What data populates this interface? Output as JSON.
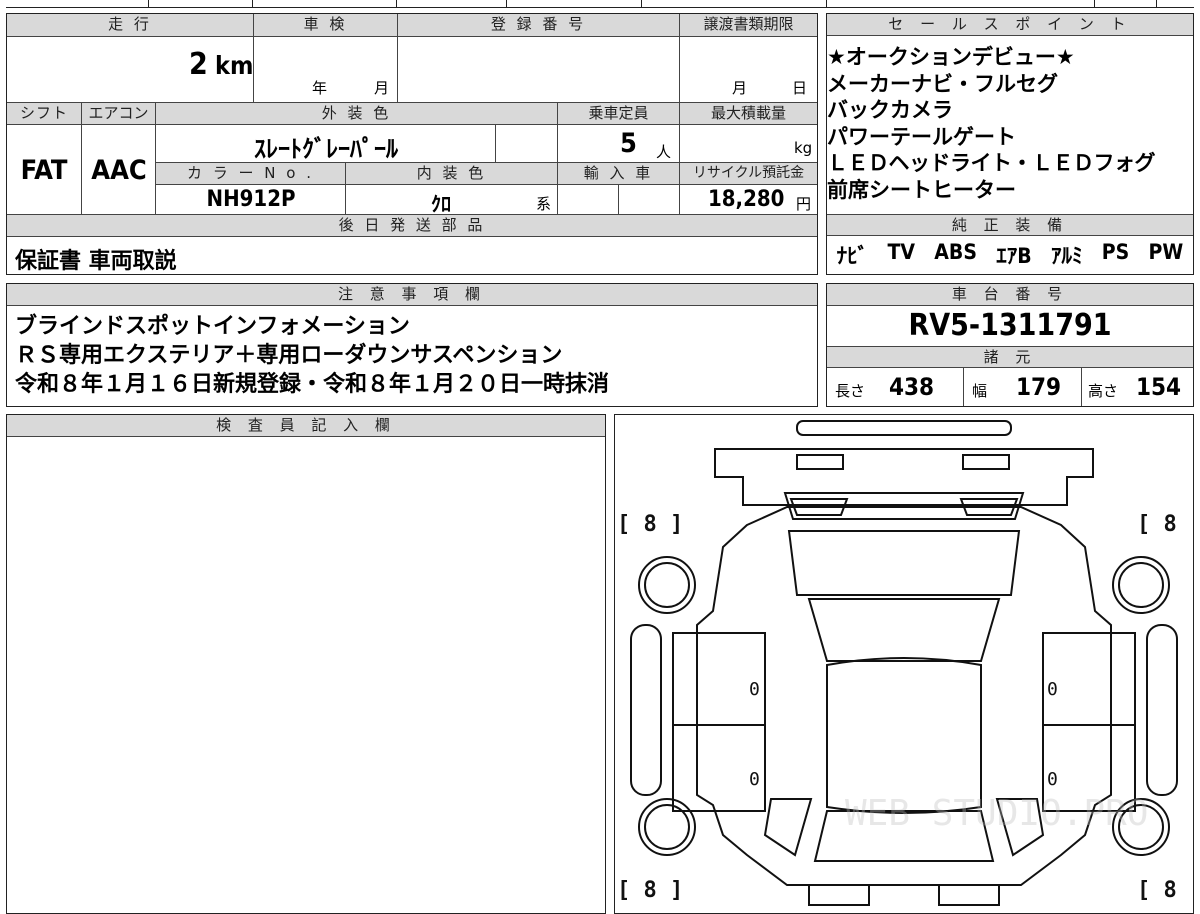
{
  "top": {
    "mileage": {
      "label": "走 行",
      "value": "2",
      "unit": "km"
    },
    "inspection": {
      "label": "車 検",
      "year_unit": "年",
      "month_unit": "月"
    },
    "registration": {
      "label": "登 録 番 号"
    },
    "transfer_deadline": {
      "label": "譲渡書類期限",
      "month_unit": "月",
      "day_unit": "日"
    },
    "shift": {
      "label": "シフト",
      "value": "FAT"
    },
    "aircon": {
      "label": "エアコン",
      "value": "AAC"
    },
    "exterior_color": {
      "label": "外 装 色",
      "value": "ｽﾚｰﾄｸﾞﾚｰﾊﾟｰﾙ"
    },
    "capacity": {
      "label": "乗車定員",
      "value": "5",
      "unit": "人"
    },
    "max_load": {
      "label": "最大積載量",
      "unit": "kg"
    },
    "color_no": {
      "label": "カ ラ ー N o .",
      "value": "NH912P"
    },
    "interior_color": {
      "label": "内 装 色",
      "value": "ｸﾛ",
      "suffix": "系"
    },
    "import": {
      "label": "輸 入 車"
    },
    "recycle": {
      "label": "リサイクル預託金",
      "value": "18,280",
      "unit": "円"
    },
    "later_parts": {
      "label": "後 日 発 送 部 品",
      "value": "保証書 車両取説"
    }
  },
  "sales_points": {
    "label": "セ ー ル ス ポ イ ン ト",
    "lines": [
      "★オークションデビュー★",
      "メーカーナビ・フルセグ",
      "バックカメラ",
      "パワーテールゲート",
      "ＬＥＤヘッドライト・ＬＥＤフォグ",
      "前席シートヒーター"
    ]
  },
  "equipment": {
    "label": "純 正 装 備",
    "items": [
      "ﾅﾋﾞ",
      "TV",
      "ABS",
      "ｴｱB",
      "ｱﾙﾐ",
      "PS",
      "PW"
    ]
  },
  "notes": {
    "label": "注 意 事 項 欄",
    "lines": [
      "ブラインドスポットインフォメーション",
      "ＲＳ専用エクステリア＋専用ローダウンサスペンション",
      "令和８年１月１６日新規登録・令和８年１月２０日一時抹消"
    ]
  },
  "chassis": {
    "label": "車 台 番 号",
    "value": "RV5-1311791"
  },
  "specs": {
    "label": "諸 元",
    "length": {
      "label": "長さ",
      "value": "438"
    },
    "width": {
      "label": "幅",
      "value": "179"
    },
    "height": {
      "label": "高さ",
      "value": "154"
    }
  },
  "inspector": {
    "label": "検 査 員 記 入 欄"
  },
  "diagram": {
    "tire_labels": [
      "[ 8 ]",
      "[ 8 ]",
      "[ 8 ]",
      "[ 8 ]"
    ],
    "door_marks": [
      "0",
      "0",
      "0",
      "0"
    ],
    "watermark": "WEB STUDIO.PRO"
  }
}
